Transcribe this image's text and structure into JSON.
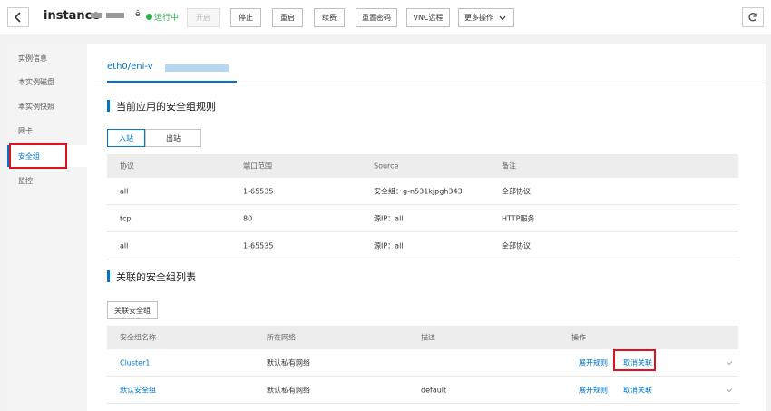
{
  "toolbar": {
    "back_icon": "chevron-left-icon",
    "instance_title": "instance",
    "status_icon_glyph": "ê",
    "status_text": "运行中",
    "buttons": [
      "开启",
      "停止",
      "重启",
      "续费",
      "重置密码",
      "VNC远程",
      "更多操作"
    ],
    "more_arrow_icon": "chevron-down-icon",
    "refresh_icon": "refresh-icon"
  },
  "sidebar": {
    "items": [
      "实例信息",
      "本实例磁盘",
      "本实例快照",
      "网卡",
      "安全组",
      "监控"
    ],
    "active": "安全组"
  },
  "eni_tab": {
    "label": "eth0/eni-v"
  },
  "current_rules": {
    "title": "当前应用的安全组规则",
    "tabs": [
      "入站",
      "出站"
    ],
    "active_tab": "入站",
    "headers": [
      "协议",
      "端口范围",
      "Source",
      "备注"
    ],
    "rows": [
      [
        "all",
        "1-65535",
        "安全组：g-n531kjpgh343",
        "全部协议"
      ],
      [
        "tcp",
        "80",
        "源IP：all",
        "HTTP服务"
      ],
      [
        "all",
        "1-65535",
        "源IP：all",
        "全部协议"
      ]
    ]
  },
  "assoc_groups": {
    "title": "关联的安全组列表",
    "button": "关联安全组",
    "headers": [
      "安全组名称",
      "所在网络",
      "描述",
      "操作"
    ],
    "rows": [
      {
        "name": "Cluster1",
        "network": "默认私有网络",
        "desc": "",
        "expand": "展开规则",
        "cancel": "取消关联"
      },
      {
        "name": "默认安全组",
        "network": "默认私有网络",
        "desc": "default",
        "expand": "展开规则",
        "cancel": "取消关联"
      }
    ]
  },
  "colors": {
    "accent": "#0076c6",
    "running": "#2ab24b",
    "highlight": "#e0101e"
  }
}
